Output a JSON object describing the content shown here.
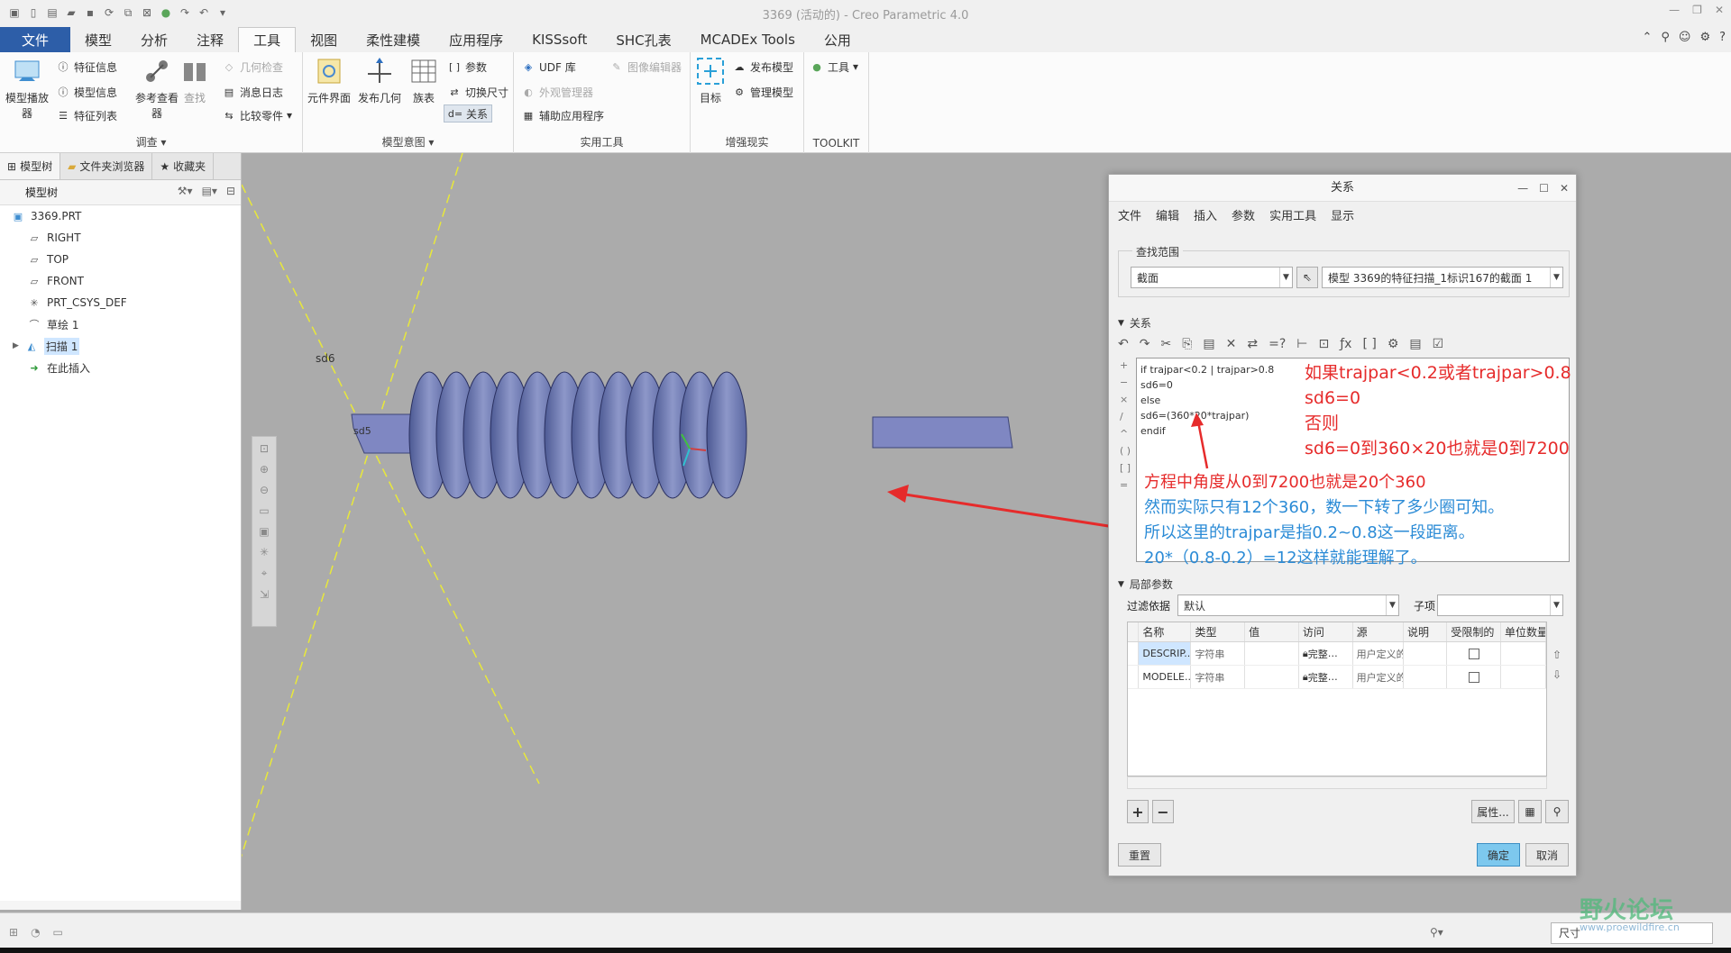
{
  "window": {
    "title": "3369 (活动的) - Creo Parametric 4.0"
  },
  "ribbon_tabs": [
    "文件",
    "模型",
    "分析",
    "注释",
    "工具",
    "视图",
    "柔性建模",
    "应用程序",
    "KISSsoft",
    "SHC孔表",
    "MCADEx Tools",
    "公用"
  ],
  "ribbon": {
    "investigate": {
      "label": "调查",
      "model_player": "模型播放器",
      "feature_info": "特征信息",
      "model_info": "模型信息",
      "feature_list": "特征列表",
      "ref_viewer": "参考查看器",
      "find": "查找",
      "geom_check": "几何检查",
      "message_log": "消息日志",
      "compare_part": "比较零件"
    },
    "model_intent": {
      "label": "模型意图",
      "component_interface": "元件界面",
      "publish_geom": "发布几何",
      "family_table": "族表",
      "params": "参数",
      "switch_dims": "切换尺寸",
      "relations": "关系"
    },
    "utilities": {
      "label": "实用工具",
      "udf_lib": "UDF 库",
      "image_editor": "图像编辑器",
      "appearance_mgr": "外观管理器",
      "aux_app": "辅助应用程序"
    },
    "ar": {
      "label": "增强现实",
      "target": "目标",
      "publish_model": "发布模型",
      "manage_model": "管理模型"
    },
    "toolkit": {
      "label": "TOOLKIT",
      "tools": "工具"
    }
  },
  "left_panel": {
    "nav_tabs": [
      "模型树",
      "文件夹浏览器",
      "收藏夹"
    ],
    "tree_header": "模型树",
    "tree_items": [
      "3369.PRT",
      "RIGHT",
      "TOP",
      "FRONT",
      "PRT_CSYS_DEF",
      "草绘 1",
      "扫描 1",
      "在此插入"
    ]
  },
  "graphics": {
    "dim_label": "sd6",
    "dim_label2": "sd5"
  },
  "dialog": {
    "title": "关系",
    "menu": [
      "文件",
      "编辑",
      "插入",
      "参数",
      "实用工具",
      "显示"
    ],
    "lookup_label": "查找范围",
    "lookup_type": "截面",
    "lookup_target": "模型 3369的特征扫描_1标识167的截面 1",
    "relations_label": "关系",
    "code_lines": [
      "if trajpar<0.2 | trajpar>0.8",
      "sd6=0",
      "else",
      "sd6=(360*20*trajpar)",
      "endif"
    ],
    "annotation_red": [
      "如果trajpar<0.2或者trajpar>0.8",
      "sd6=0",
      "否则",
      "sd6=0到360×20也就是0到7200"
    ],
    "annotation_line1": "方程中角度从0到7200也就是20个360",
    "annotation_blue": [
      "然而实际只有12个360，数一下转了多少圈可知。",
      "所以这里的trajpar是指0.2~0.8这一段距离。",
      "20*（0.8-0.2）=12这样就能理解了。"
    ],
    "local_params_label": "局部参数",
    "filter_label": "过滤依据",
    "filter_value": "默认",
    "sub_label": "子项",
    "table_headers": [
      "名称",
      "类型",
      "值",
      "访问",
      "源",
      "说明",
      "受限制的",
      "单位数量"
    ],
    "table_rows": [
      {
        "name": "DESCRIP...",
        "type": "字符串",
        "value": "",
        "access": "完整",
        "source": "用户定义的"
      },
      {
        "name": "MODELE...",
        "type": "字符串",
        "value": "",
        "access": "完整",
        "source": "用户定义的"
      }
    ],
    "properties_btn": "属性...",
    "reset_btn": "重置",
    "ok_btn": "确定",
    "cancel_btn": "取消"
  },
  "status": {
    "filter_value": "尺寸",
    "watermark": "野火论坛",
    "watermark_url": "www.proewildfire.cn"
  }
}
